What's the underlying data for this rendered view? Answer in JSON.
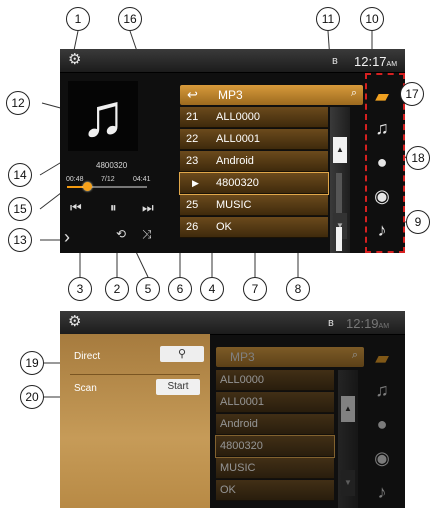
{
  "callouts": [
    "1",
    "16",
    "11",
    "10",
    "12",
    "17",
    "18",
    "14",
    "15",
    "13",
    "9",
    "3",
    "2",
    "5",
    "6",
    "4",
    "7",
    "8",
    "19",
    "20"
  ],
  "screen1": {
    "clock": "12:17",
    "clock_suffix": "AM",
    "now_playing": "4800320",
    "time_elapsed": "00:48",
    "track_count": "7/12",
    "time_total": "04:41",
    "playback_progress": 0.25,
    "list_header": "MP3",
    "rows": [
      {
        "num": "21",
        "name": "ALL0000"
      },
      {
        "num": "22",
        "name": "ALL0001"
      },
      {
        "num": "23",
        "name": "Android"
      },
      {
        "num": "",
        "name": "4800320"
      },
      {
        "num": "25",
        "name": "MUSIC"
      },
      {
        "num": "26",
        "name": "OK"
      }
    ]
  },
  "screen2": {
    "clock": "12:19",
    "clock_suffix": "AM",
    "direct_label": "Direct",
    "scan_label": "Scan",
    "start_label": "Start",
    "list_header": "MP3",
    "rows": [
      "ALL0000",
      "ALL0001",
      "Android",
      "4800320",
      "MUSIC",
      "OK"
    ]
  },
  "icons": {
    "settings": "gear-icon",
    "bluetooth": "bluetooth-icon",
    "album_art": "music-note-icon",
    "previous": "previous-track-icon",
    "pause": "pause-icon",
    "next": "next-track-icon",
    "repeat": "repeat-icon",
    "shuffle": "shuffle-icon",
    "back": "back-arrow-icon",
    "return": "return-icon",
    "search": "search-icon",
    "sources": [
      "folder-icon",
      "music-note-icon",
      "artist-icon",
      "album-disc-icon",
      "genre-guitar-icon"
    ]
  },
  "colors": {
    "accent": "#f39a10",
    "highlight_box": "#d62020",
    "row": "#5a3d15"
  }
}
